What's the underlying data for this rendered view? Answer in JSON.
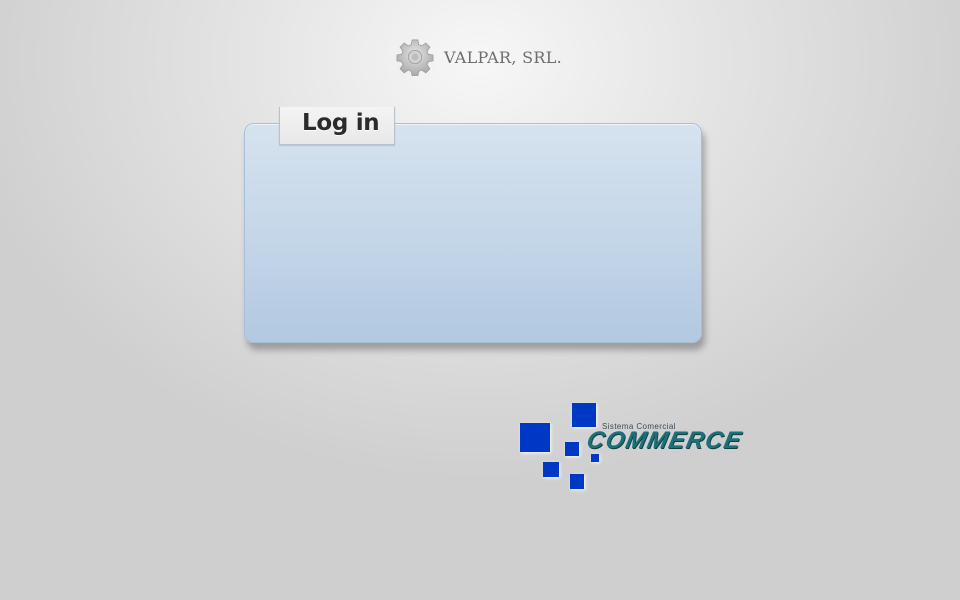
{
  "header": {
    "company_name": "VALPAR, SRL.",
    "icon": "gear-icon"
  },
  "login": {
    "title": "Log in"
  },
  "logo": {
    "subtitle": "Sistema Comercial",
    "name": "COMMERCE",
    "square_color": "#0039c6",
    "text_color": "#1d6f78"
  },
  "colors": {
    "panel": "#c3d5e8",
    "background": "#dcdcdc"
  }
}
